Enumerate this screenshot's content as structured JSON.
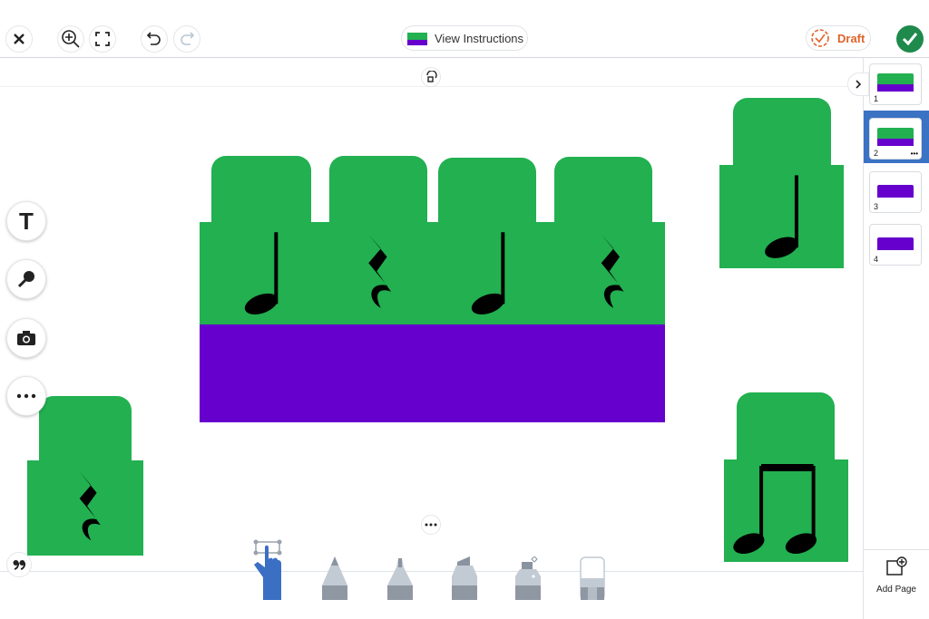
{
  "toolbar": {
    "view_instructions": "View Instructions",
    "draft": "Draft",
    "icons": [
      "close-icon",
      "zoom-in-icon",
      "fullscreen-icon",
      "undo-icon",
      "redo-icon",
      "check-icon"
    ]
  },
  "colors": {
    "green": "#22b050",
    "purple": "#6600cc",
    "selected": "#3a72c4",
    "draft": "#e0632a",
    "done": "#1e8a4c",
    "tool_active": "#3a6fc4"
  },
  "canvas": {
    "blocks": [
      "quarter-note",
      "quarter-rest",
      "quarter-note",
      "quarter-rest"
    ],
    "loose_blocks": [
      "quarter-note",
      "quarter-rest",
      "eighth-note-pair"
    ]
  },
  "left_tools": [
    "text-tool",
    "microphone-tool",
    "camera-tool",
    "more-tool"
  ],
  "left_tool_labels": {
    "text": "T"
  },
  "bottom_tools": [
    "select-hand",
    "pencil",
    "marker",
    "highlighter",
    "glitter-pen",
    "eraser"
  ],
  "pages": [
    {
      "number": "1"
    },
    {
      "number": "2",
      "selected": true,
      "more": "•••"
    },
    {
      "number": "3"
    },
    {
      "number": "4"
    }
  ],
  "add_page": "Add Page"
}
